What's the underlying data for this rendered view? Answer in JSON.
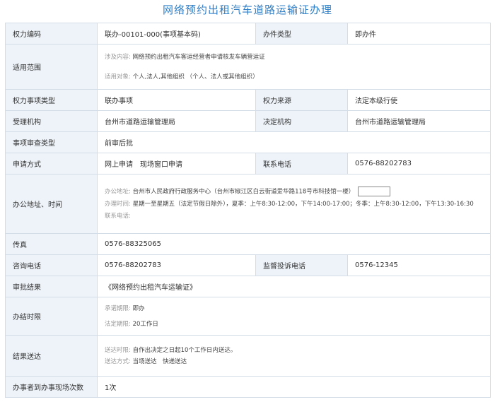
{
  "title": "网络预约出租汽车道路运输证办理",
  "rows": {
    "power_code": {
      "label": "权力编码",
      "value": "联办-00101-000(事项基本码)"
    },
    "handle_type": {
      "label": "办件类型",
      "value": "即办件"
    },
    "scope": {
      "label": "适用范围",
      "content_key": "涉及内容:",
      "content_val": "网络预约出租汽车客运经营者申请核发车辆营运证",
      "target_key": "适用对象:",
      "target_val": "个人,法人,其他组织 （个人、法人或其他组织）"
    },
    "item_type": {
      "label": "权力事项类型",
      "value": "联办事项"
    },
    "power_source": {
      "label": "权力来源",
      "value": "法定本级行使"
    },
    "accept_org": {
      "label": "受理机构",
      "value": "台州市道路运输管理局"
    },
    "decide_org": {
      "label": "决定机构",
      "value": "台州市道路运输管理局"
    },
    "review_type": {
      "label": "事项审查类型",
      "value": "前审后批"
    },
    "apply_method": {
      "label": "申请方式",
      "value": "网上申请　现场窗口申请"
    },
    "contact_phone": {
      "label": "联系电话",
      "value": "0576-88202783"
    },
    "office": {
      "label": "办公地址、时间",
      "addr_key": "办公地址:",
      "addr_val": "台州市人民政府行政服务中心（台州市椒江区白云街道爱华路118号市科技馆一楼）",
      "time_key": "办理时间:",
      "time_val": "星期一至星期五（法定节假日除外），夏季：上午8:30-12:00，下午14:00-17:00；冬季：上午8:30-12:00，下午13:30-16:30",
      "phone_key": "联系电话:"
    },
    "fax": {
      "label": "传真",
      "value": "0576-88325065"
    },
    "consult_phone": {
      "label": "咨询电话",
      "value": "0576-88202783"
    },
    "complaint_phone": {
      "label": "监督投诉电话",
      "value": "0576-12345"
    },
    "result": {
      "label": "审批结果",
      "value": "《网络预约出租汽车运输证》"
    },
    "time_limit": {
      "label": "办结时限",
      "promise_key": "承诺期限:",
      "promise_val": "即办",
      "legal_key": "法定期限:",
      "legal_val": "20工作日"
    },
    "delivery": {
      "label": "结果送达",
      "time_key": "送达时限:",
      "time_val": "自作出决定之日起10个工作日内送达。",
      "method_key": "送达方式:",
      "method_val": "当场送达　快递送达"
    },
    "visits": {
      "label": "办事者到办事现场次数",
      "value": "1次"
    }
  }
}
